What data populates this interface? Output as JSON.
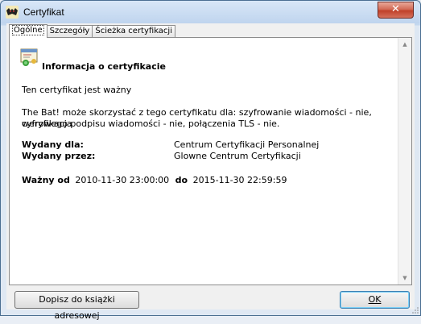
{
  "window": {
    "title": "Certyfikat",
    "close_label": "✕"
  },
  "tabs": [
    {
      "label": "Ogólne"
    },
    {
      "label": "Szczegóły"
    },
    {
      "label": "Ścieżka certyfikacji"
    }
  ],
  "general": {
    "heading": "Informacja o certyfikacie",
    "status": "Ten certyfikat jest ważny",
    "usage_line1": "The Bat! może skorzystać z tego certyfikatu dla: szyfrowanie wiadomości - nie, weryfikacja",
    "usage_line2": "cyfrowego podpisu wiadomości - nie, połączenia TLS - nie.",
    "issued_to_label": "Wydany dla:",
    "issued_to_value": "Centrum Certyfikacji Personalnej",
    "issued_by_label": "Wydany przez:",
    "issued_by_value": "Glowne Centrum Certyfikacji",
    "valid_from_label": "Ważny od",
    "valid_from_value": "2010-11-30 23:00:00",
    "valid_to_label": "do",
    "valid_to_value": "2015-11-30 22:59:59"
  },
  "buttons": {
    "add_to_address_book": "Dopisz do książki adresowej",
    "ok": "OK"
  },
  "icons": {
    "app": "bat-icon",
    "certificate": "certificate-icon",
    "close": "close-icon"
  }
}
